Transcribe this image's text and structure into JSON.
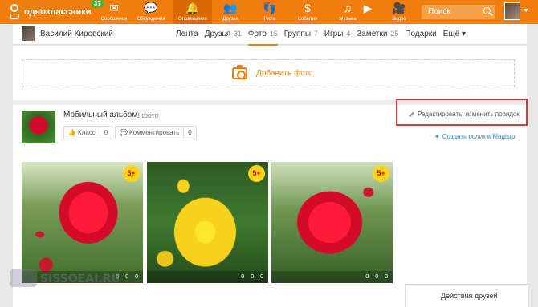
{
  "topbar": {
    "logo_text": "одноклассники",
    "badge": "37",
    "nav": [
      {
        "label": "Сообщения",
        "icon": "envelope-icon",
        "glyph": "✉",
        "active": false
      },
      {
        "label": "Обсуждения",
        "icon": "chat-icon",
        "glyph": "💬",
        "active": false
      },
      {
        "label": "Оповещения",
        "icon": "bell-icon",
        "glyph": "🔔",
        "active": true
      },
      {
        "label": "Друзья",
        "icon": "friends-icon",
        "glyph": "👥",
        "active": false
      },
      {
        "label": "Гости",
        "icon": "footprints-icon",
        "glyph": "👣",
        "active": false
      },
      {
        "label": "События",
        "icon": "dollar-icon",
        "glyph": "$",
        "active": false
      },
      {
        "label": "Музыка",
        "icon": "music-icon",
        "glyph": "♫",
        "active": false
      },
      {
        "label": "",
        "icon": "video-play-icon",
        "glyph": "▶",
        "active": false
      },
      {
        "label": "Видео",
        "icon": "camera-video-icon",
        "glyph": "🎥",
        "active": false
      }
    ],
    "search_placeholder": "Поиск"
  },
  "profile": {
    "name": "Василий Кировский",
    "tabs": [
      {
        "label": "Лента",
        "count": ""
      },
      {
        "label": "Друзья",
        "count": "31"
      },
      {
        "label": "Фото",
        "count": "15"
      },
      {
        "label": "Группы",
        "count": "7"
      },
      {
        "label": "Игры",
        "count": "4"
      },
      {
        "label": "Заметки",
        "count": "25"
      },
      {
        "label": "Подарки",
        "count": ""
      },
      {
        "label": "Ещё ▾",
        "count": ""
      }
    ]
  },
  "add_photo_label": "Добавить фото",
  "album": {
    "title": "Мобильный альбом",
    "count_label": "3 фото",
    "like_label": "Класс",
    "like_count": "0",
    "comment_label": "Комментировать",
    "comment_count": "0",
    "edit_label": "Редактировать, изменить порядок",
    "magisto_label": "Создать ролик в Magisto"
  },
  "photos": [
    {
      "badge": "5+",
      "stats": [
        "0",
        "0",
        "0"
      ]
    },
    {
      "badge": "5+",
      "stats": [
        "0",
        "0",
        "0"
      ]
    },
    {
      "badge": "5+",
      "stats": [
        "0",
        "0",
        "0"
      ]
    }
  ],
  "friends_activity": "Действия друзей",
  "watermark": "SISSOEAI.RU",
  "colors": {
    "brand": "#f07e0e",
    "highlight": "#d63a3a",
    "link": "#2f8fd0"
  }
}
